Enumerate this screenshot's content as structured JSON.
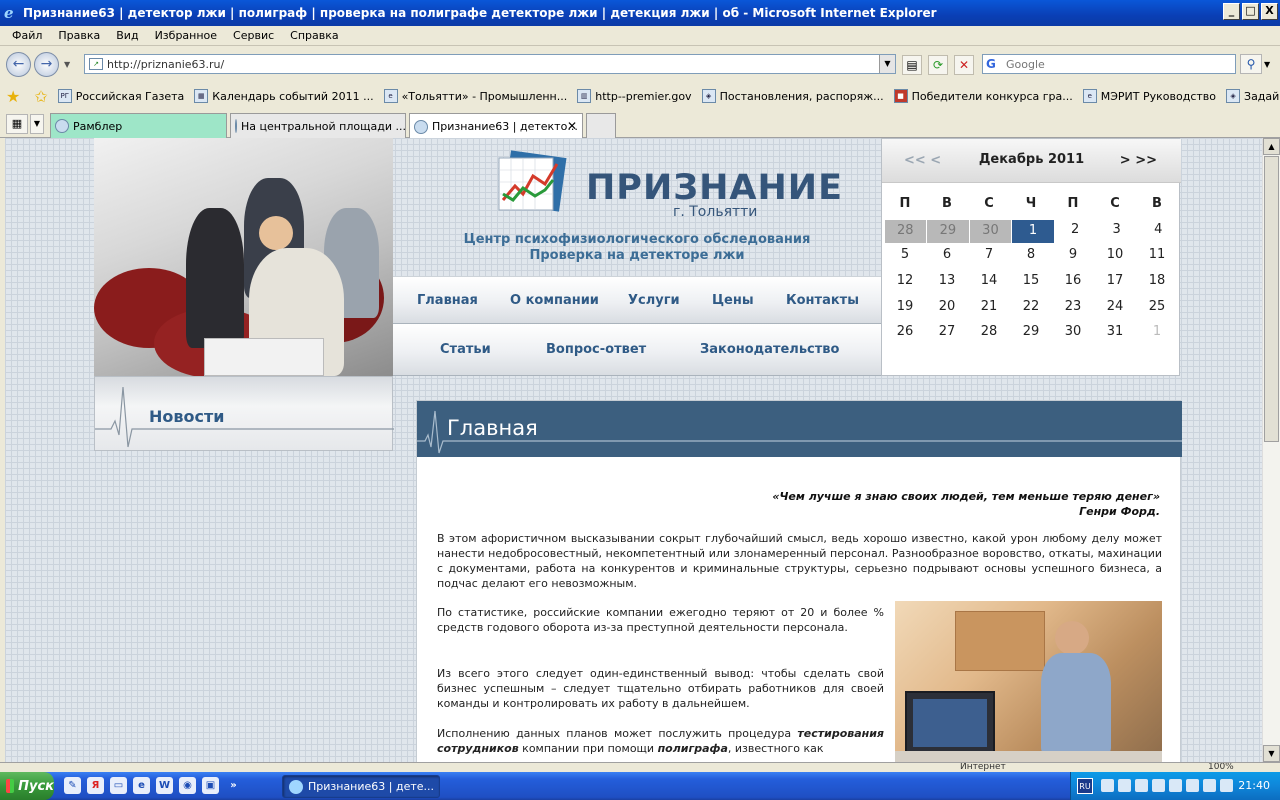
{
  "window": {
    "title": "Признание63 | детектор лжи | полиграф | проверка на полиграфе детекторе лжи | детекция лжи | об - Microsoft Internet Explorer",
    "minimize": "_",
    "maximize": "□",
    "close": "X"
  },
  "menu": [
    "Файл",
    "Правка",
    "Вид",
    "Избранное",
    "Сервис",
    "Справка"
  ],
  "address": {
    "url": "http://priznanie63.ru/"
  },
  "search": {
    "placeholder": "Google"
  },
  "favorites": [
    {
      "label": "Российская Газета",
      "icon": "РГ"
    },
    {
      "label": "Календарь событий 2011 ...",
      "icon": "▦"
    },
    {
      "label": "«Тольятти» - Промышленн...",
      "icon": "e"
    },
    {
      "label": "http--premier.gov",
      "icon": "▥"
    },
    {
      "label": "Постановления, распоряж...",
      "icon": "◈"
    },
    {
      "label": "Победители конкурса гра...",
      "icon": "■"
    },
    {
      "label": "МЭРИТ  Руководство",
      "icon": "e"
    },
    {
      "label": "Задай вопрос мэру",
      "icon": "◈"
    }
  ],
  "tabs": [
    {
      "label": "Рамблер"
    },
    {
      "label": "На центральной площади ..."
    },
    {
      "label": "Признание63 | детекто..."
    }
  ],
  "site": {
    "logo_text": "ПРИЗНАНИЕ",
    "logo_city": "г. Тольятти",
    "tagline1": "Центр психофизиологического обследования",
    "tagline2": "Проверка на детекторе лжи",
    "nav1": [
      "Главная",
      "О компании",
      "Услуги",
      "Цены",
      "Контакты"
    ],
    "nav2": [
      "Статьи",
      "Вопрос-ответ",
      "Законодательство"
    ],
    "news_title": "Новости",
    "calendar": {
      "prev": "<< <",
      "month": "Декабрь 2011",
      "next": "> >>",
      "dow": [
        "П",
        "В",
        "С",
        "Ч",
        "П",
        "С",
        "В"
      ],
      "weeks": [
        [
          "28",
          "29",
          "30",
          "1",
          "2",
          "3",
          "4"
        ],
        [
          "5",
          "6",
          "7",
          "8",
          "9",
          "10",
          "11"
        ],
        [
          "12",
          "13",
          "14",
          "15",
          "16",
          "17",
          "18"
        ],
        [
          "19",
          "20",
          "21",
          "22",
          "23",
          "24",
          "25"
        ],
        [
          "26",
          "27",
          "28",
          "29",
          "30",
          "31",
          "1"
        ]
      ]
    },
    "content": {
      "heading": "Главная",
      "quote_line1": "«Чем лучше я знаю своих людей, тем меньше теряю денег»",
      "quote_line2": "Генри Форд.",
      "p1": "В этом афористичном высказывании сокрыт глубочайший смысл, ведь хорошо известно, какой урон любому делу может нанести недобросовестный, некомпетентный или злонамеренный персонал. Разнообразное воровство, откаты, махинации с документами, работа на конкурентов и криминальные структуры, серьезно подрывают основы успешного бизнеса, а подчас делают его невозможным.",
      "p2": "По статистике, российские компании ежегодно теряют от 20 и более % средств годового оборота из-за преступной деятельности персонала.",
      "p3": "Из всего этого следует один-единственный вывод: чтобы сделать свой бизнес успешным – следует тщательно отбирать работников для своей команды и контролировать их работу в дальнейшем.",
      "p4_a": "Исполнению данных планов может послужить процедура ",
      "p4_b": "тестирования сотрудников",
      "p4_c": " компании при помощи ",
      "p4_d": "полиграфа",
      "p4_e": ", известного как"
    }
  },
  "statusbar": {
    "zone": "Интернет",
    "zoom": "100%"
  },
  "taskbar": {
    "start": "Пуск",
    "task": "Признание63 | дете...",
    "lang": "RU",
    "clock": "21:40"
  }
}
